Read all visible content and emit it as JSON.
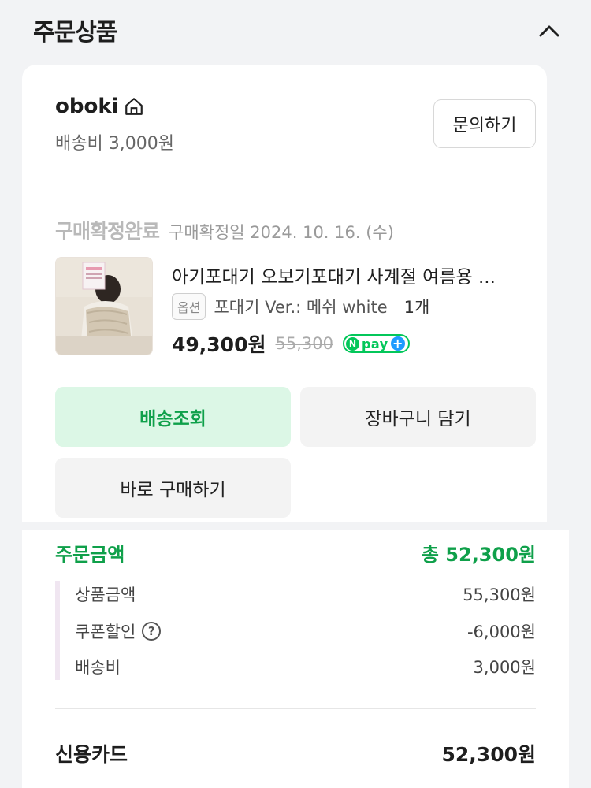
{
  "section": {
    "title": "주문상품"
  },
  "store": {
    "name": "oboki",
    "shipping_fee": "배송비 3,000원",
    "inquiry_label": "문의하기"
  },
  "order": {
    "status": "구매확정완료",
    "confirm_date": "구매확정일 2024. 10. 16. (수)"
  },
  "product": {
    "name": "아기포대기 오보기포대기 사계절 여름용 ...",
    "option_tag": "옵션",
    "option_text": "포대기 Ver.: 메쉬 white",
    "quantity": "1개",
    "price": "49,300원",
    "original_price": "55,300",
    "npay_text": "pay"
  },
  "actions": {
    "track_label": "배송조회",
    "cart_label": "장바구니 담기",
    "buy_now_label": "바로 구매하기"
  },
  "summary": {
    "label": "주문금액",
    "total": "총 52,300원",
    "rows": [
      {
        "label": "상품금액",
        "value": "55,300원"
      },
      {
        "label": "쿠폰할인",
        "value": "-6,000원"
      },
      {
        "label": "배송비",
        "value": "3,000원"
      }
    ],
    "payment_method": "신용카드",
    "payment_amount": "52,300원"
  },
  "colors": {
    "accent_green": "#0fa04a",
    "track_bg": "#dcf7e6",
    "npay_green": "#03c75a"
  },
  "icons": [
    "chevron-up-icon",
    "home-icon",
    "help-icon",
    "npay-logo"
  ]
}
